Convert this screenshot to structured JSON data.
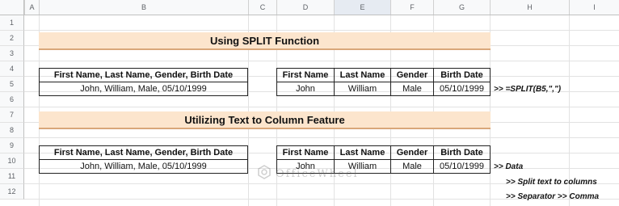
{
  "columns": [
    "A",
    "B",
    "C",
    "D",
    "E",
    "F",
    "G",
    "H",
    "I"
  ],
  "rows": [
    "1",
    "2",
    "3",
    "4",
    "5",
    "6",
    "7",
    "8",
    "9",
    "10",
    "11",
    "12"
  ],
  "section1": {
    "title": "Using SPLIT Function",
    "source_header": "First Name, Last Name, Gender, Birth Date",
    "source_value": "John, William, Male, 05/10/1999",
    "headers": [
      "First Name",
      "Last Name",
      "Gender",
      "Birth Date"
    ],
    "values": [
      "John",
      "William",
      "Male",
      "05/10/1999"
    ],
    "formula_note": ">> =SPLIT(B5,\",\")"
  },
  "section2": {
    "title": "Utilizing Text to Column Feature",
    "source_header": "First Name, Last Name, Gender, Birth Date",
    "source_value": "John, William, Male, 05/10/1999",
    "headers": [
      "First Name",
      "Last Name",
      "Gender",
      "Birth Date"
    ],
    "values": [
      "John",
      "William",
      "Male",
      "05/10/1999"
    ],
    "steps": [
      ">> Data",
      ">> Split text to columns",
      ">> Separator >> Comma"
    ]
  },
  "watermark": "OfficeWheel"
}
